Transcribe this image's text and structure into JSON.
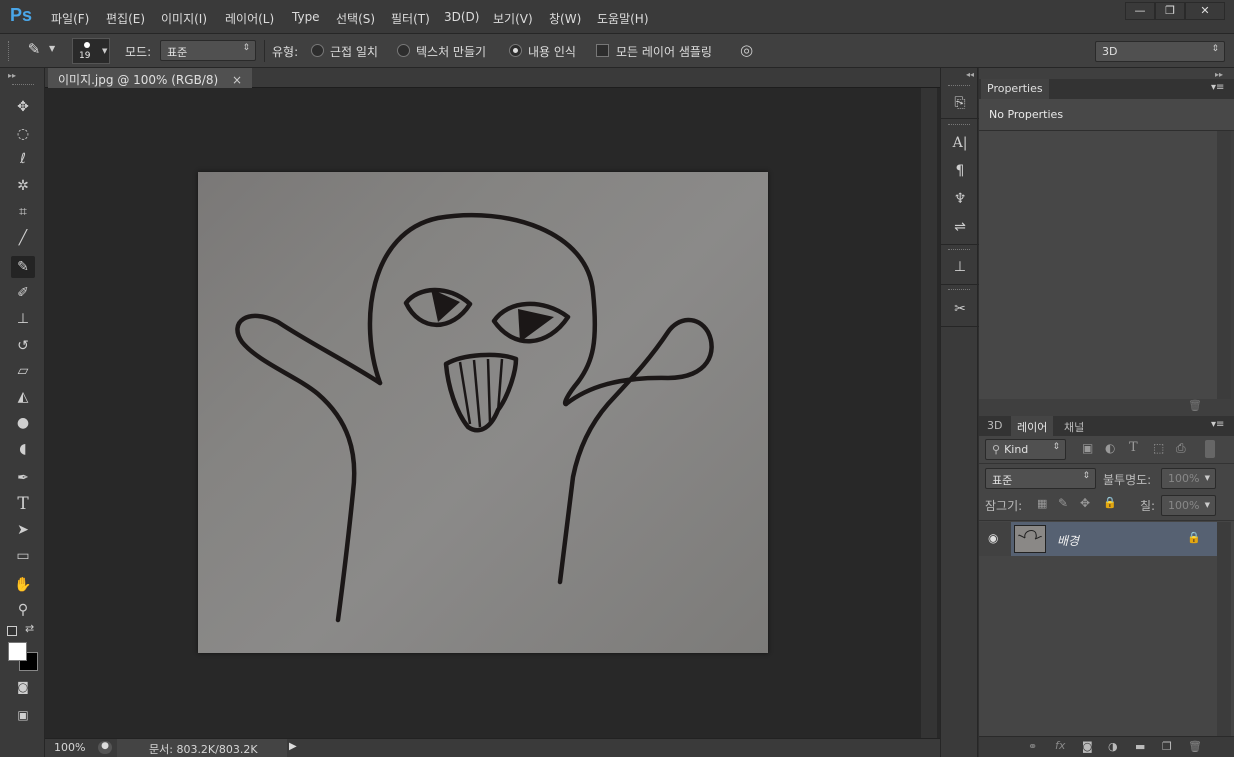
{
  "app": {
    "logo": "Ps"
  },
  "menu": [
    {
      "label": "파일(F)"
    },
    {
      "label": "편집(E)"
    },
    {
      "label": "이미지(I)"
    },
    {
      "label": "레이어(L)"
    },
    {
      "label": "Type"
    },
    {
      "label": "선택(S)"
    },
    {
      "label": "필터(T)"
    },
    {
      "label": "3D(D)"
    },
    {
      "label": "보기(V)"
    },
    {
      "label": "창(W)"
    },
    {
      "label": "도움말(H)"
    }
  ],
  "window_controls": {
    "minimize": "—",
    "restore": "❐",
    "close": "✕"
  },
  "options": {
    "brush_size": "19",
    "mode_label": "모드:",
    "mode_value": "표준",
    "type_label": "유형:",
    "type_options": [
      "근접 일치",
      "텍스처 만들기",
      "내용 인식"
    ],
    "type_selected": 2,
    "sample_all_label": "모든 레이어 샘플링",
    "workspace": "3D"
  },
  "document": {
    "tab_title": "이미지.jpg @ 100% (RGB/8)",
    "close": "×",
    "zoom": "100%",
    "doc_info": "문서: 803.2K/803.2K"
  },
  "properties": {
    "tab": "Properties",
    "content": "No Properties"
  },
  "layers_panel": {
    "tabs": [
      "3D",
      "레이어",
      "채널"
    ],
    "active_tab": 1,
    "filter_kind": "Kind",
    "blend_mode": "표준",
    "opacity_label": "불투명도:",
    "opacity_value": "100%",
    "lock_label": "잠그기:",
    "fill_label": "칠:",
    "fill_value": "100%",
    "layers": [
      {
        "name": "배경",
        "locked": true,
        "visible": true
      }
    ]
  },
  "colors": {
    "accent": "#4aa6e8",
    "selected_layer": "#566172",
    "ui_bg": "#3a3a3a"
  }
}
